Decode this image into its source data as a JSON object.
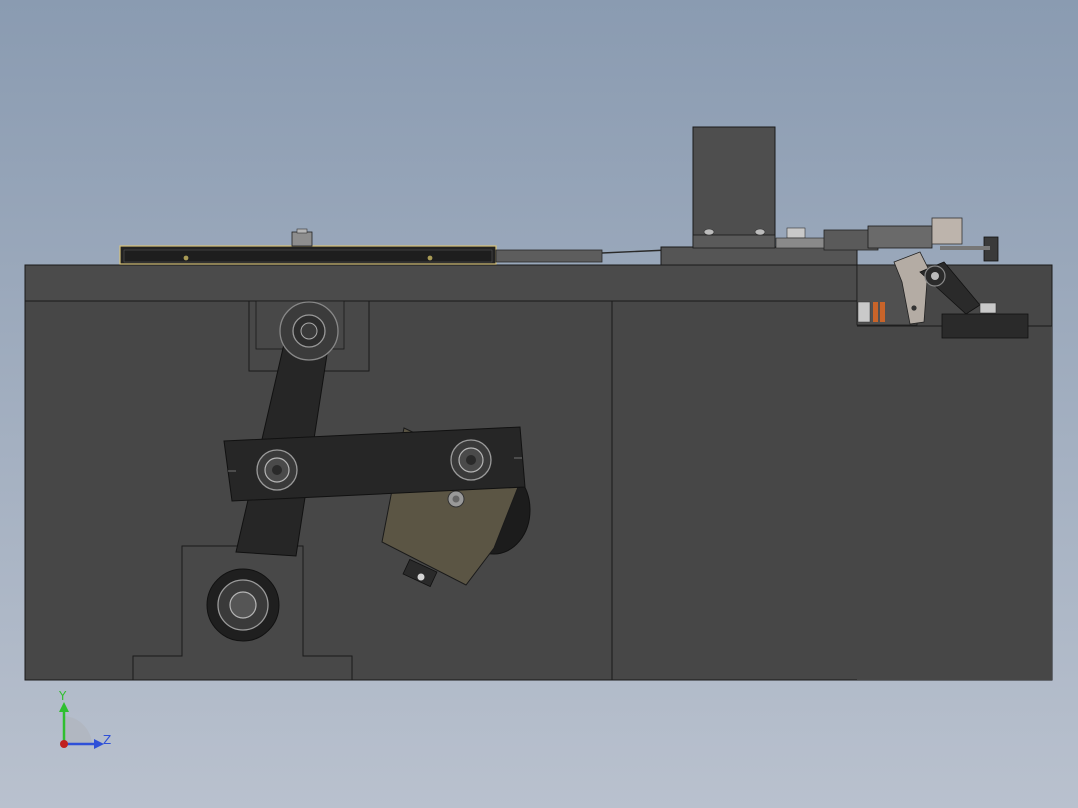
{
  "view": {
    "background_top": "#8a9bb1",
    "background_bottom": "#b9c1ce",
    "body_color": "#474747",
    "edge_color": "#1a1a1a",
    "arm_color": "#262626",
    "bracket_color": "#5b5544",
    "accent_orange": "#c8642a",
    "lever_color": "#b4aca4"
  },
  "triad": {
    "y_label": "Y",
    "z_label": "Z",
    "y_color": "#2fbf2f",
    "z_color": "#2f50d8",
    "x_color": "#c02020"
  }
}
